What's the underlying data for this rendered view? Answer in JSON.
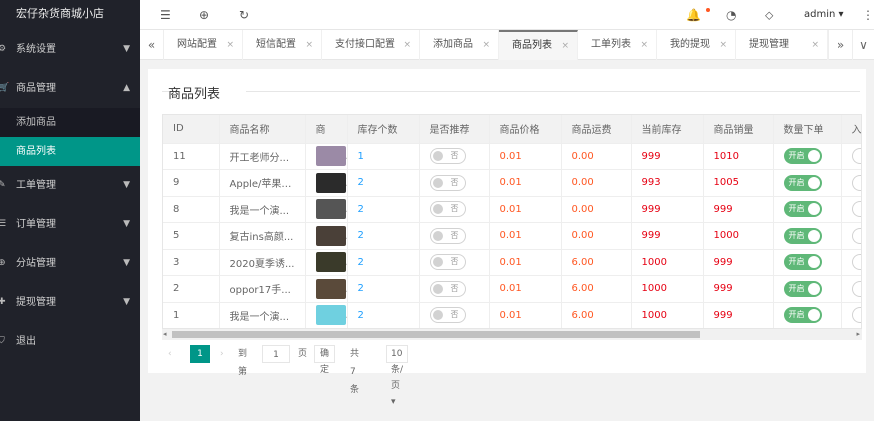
{
  "app": {
    "title": "宏仔杂货商城小店"
  },
  "sidebar": {
    "groups": [
      {
        "label": "系统设置"
      },
      {
        "label": "商品管理",
        "children": [
          {
            "label": "添加商品"
          },
          {
            "label": "商品列表"
          }
        ]
      },
      {
        "label": "工单管理"
      },
      {
        "label": "订单管理"
      },
      {
        "label": "分站管理"
      },
      {
        "label": "提现管理"
      },
      {
        "label": "退出"
      }
    ]
  },
  "header": {
    "user": "admin"
  },
  "tabs": [
    "网站配置",
    "短信配置",
    "支付接口配置",
    "添加商品",
    "商品列表",
    "工单列表",
    "我的提现",
    "提现管理"
  ],
  "page": {
    "title": "商品列表"
  },
  "table": {
    "columns": [
      "ID",
      "商品名称",
      "商",
      "库存个数",
      "是否推荐",
      "商品价格",
      "商品运费",
      "当前库存",
      "商品销量",
      "数量下单",
      "入库"
    ],
    "rows": [
      {
        "id": "11",
        "name": "开工老师分...",
        "stock_count": "1",
        "recommend": "否",
        "price": "0.01",
        "shipping": "0.00",
        "current_stock": "999",
        "sales": "1010",
        "order_switch": "开启"
      },
      {
        "id": "9",
        "name": "Apple/苹果 i...",
        "stock_count": "2",
        "recommend": "否",
        "price": "0.01",
        "shipping": "0.00",
        "current_stock": "993",
        "sales": "1005",
        "order_switch": "开启"
      },
      {
        "id": "8",
        "name": "我是一个演...",
        "stock_count": "2",
        "recommend": "否",
        "price": "0.01",
        "shipping": "0.00",
        "current_stock": "999",
        "sales": "999",
        "order_switch": "开启"
      },
      {
        "id": "5",
        "name": "复古ins高颜...",
        "stock_count": "2",
        "recommend": "否",
        "price": "0.01",
        "shipping": "0.00",
        "current_stock": "999",
        "sales": "1000",
        "order_switch": "开启"
      },
      {
        "id": "3",
        "name": "2020夏季诱...",
        "stock_count": "2",
        "recommend": "否",
        "price": "0.01",
        "shipping": "6.00",
        "current_stock": "1000",
        "sales": "999",
        "order_switch": "开启"
      },
      {
        "id": "2",
        "name": "oppor17手...",
        "stock_count": "2",
        "recommend": "否",
        "price": "0.01",
        "shipping": "6.00",
        "current_stock": "1000",
        "sales": "999",
        "order_switch": "开启"
      },
      {
        "id": "1",
        "name": "我是一个演...",
        "stock_count": "2",
        "recommend": "否",
        "price": "0.01",
        "shipping": "6.00",
        "current_stock": "1000",
        "sales": "999",
        "order_switch": "开启"
      }
    ]
  },
  "pager": {
    "current": "1",
    "goto_label": "到第",
    "goto_value": "1",
    "page_unit": "页",
    "confirm": "确定",
    "total": "共 7 条",
    "page_size": "10 条/页"
  },
  "colors": {
    "sidebar_bg": "#20222a",
    "active_item": "#009688",
    "switch_on": "#5fb878",
    "link_blue": "#1e9fff",
    "price_red": "#ff5722"
  },
  "icons": {
    "header": [
      "menu-fold-icon",
      "globe-icon",
      "refresh-icon",
      "bell-icon",
      "dashboard-icon",
      "tag-icon",
      "more-vertical-icon"
    ],
    "sidebar": [
      "gear-icon",
      "cart-icon",
      "wrench-icon",
      "order-icon",
      "site-icon",
      "withdraw-icon",
      "logout-icon"
    ]
  }
}
